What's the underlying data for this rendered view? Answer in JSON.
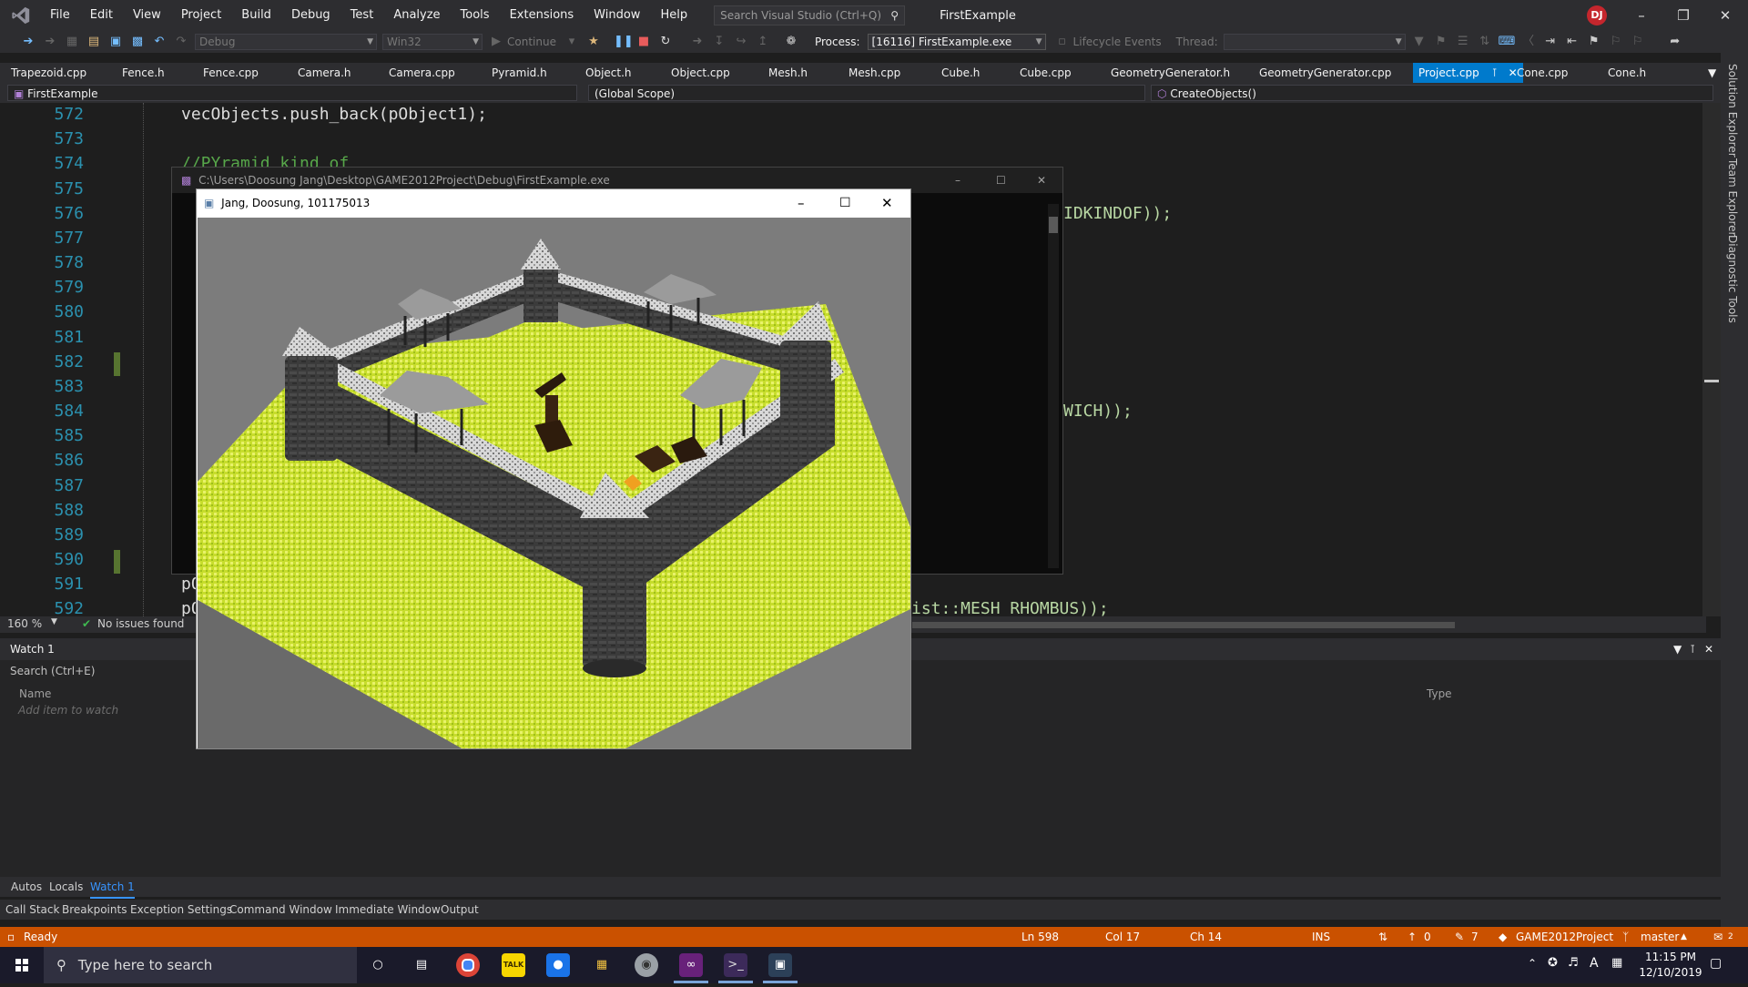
{
  "menubar": {
    "items": [
      "File",
      "Edit",
      "View",
      "Project",
      "Build",
      "Debug",
      "Test",
      "Analyze",
      "Tools",
      "Extensions",
      "Window",
      "Help"
    ],
    "search_placeholder": "Search Visual Studio (Ctrl+Q)",
    "solution_name": "FirstExample",
    "user_initials": "DJ"
  },
  "toolbar": {
    "config": "Debug",
    "platform": "Win32",
    "continue_label": "Continue",
    "process_label": "Process:",
    "process_value": "[16116] FirstExample.exe",
    "lifecycle_label": "Lifecycle Events",
    "thread_label": "Thread:"
  },
  "tabs": [
    "Trapezoid.cpp",
    "Fence.h",
    "Fence.cpp",
    "Camera.h",
    "Camera.cpp",
    "Pyramid.h",
    "Object.h",
    "Object.cpp",
    "Mesh.h",
    "Mesh.cpp",
    "Cube.h",
    "Cube.cpp",
    "GeometryGenerator.h",
    "GeometryGenerator.cpp",
    "Project.cpp",
    "Cone.cpp",
    "Cone.h"
  ],
  "active_tab": "Project.cpp",
  "nav": {
    "project": "FirstExample",
    "scope": "(Global Scope)",
    "member": "CreateObjects()"
  },
  "editor": {
    "line_numbers": [
      "572",
      "573",
      "574",
      "575",
      "576",
      "577",
      "578",
      "579",
      "580",
      "581",
      "582",
      "583",
      "584",
      "585",
      "586",
      "587",
      "588",
      "589",
      "590",
      "591",
      "592"
    ],
    "line_572": "vecObjects.push_back(pObject1);",
    "line_574_comment": "//PYramid kind of",
    "line_576_tail": "IDKINDOF));",
    "line_584_tail": "WICH));",
    "line_591_head": "pO",
    "line_592_head": "pO",
    "line_592_tail": "ist::MESH_RHOMBUS));",
    "zoom": "160 %",
    "issues": "No issues found"
  },
  "watch": {
    "title": "Watch 1",
    "search_placeholder": "Search (Ctrl+E)",
    "col_name": "Name",
    "col_type": "Type",
    "add_item": "Add item to watch",
    "bottom_tabs": [
      "Autos",
      "Locals",
      "Watch 1"
    ],
    "debug_tabs": [
      "Call Stack",
      "Breakpoints",
      "Exception Settings",
      "Command Window",
      "Immediate Window",
      "Output"
    ]
  },
  "right_dock": [
    "Solution Explorer",
    "Team Explorer",
    "Diagnostic Tools"
  ],
  "console": {
    "title": "C:\\Users\\Doosung Jang\\Desktop\\GAME2012Project\\Debug\\FirstExample.exe"
  },
  "app_window": {
    "title": "Jang, Doosung, 101175013"
  },
  "statusbar": {
    "ready": "Ready",
    "ln": "Ln 598",
    "col": "Col 17",
    "ch": "Ch 14",
    "ins": "INS",
    "up_count": "0",
    "edit_count": "7",
    "repo": "GAME2012Project",
    "branch": "master",
    "notif": "2"
  },
  "taskbar": {
    "search_placeholder": "Type here to search",
    "time": "11:15 PM",
    "date": "12/10/2019"
  },
  "colors": {
    "status_orange": "#ca5100",
    "accent_blue": "#007acc",
    "line_number": "#2b91af",
    "comment_green": "#57a64a"
  }
}
